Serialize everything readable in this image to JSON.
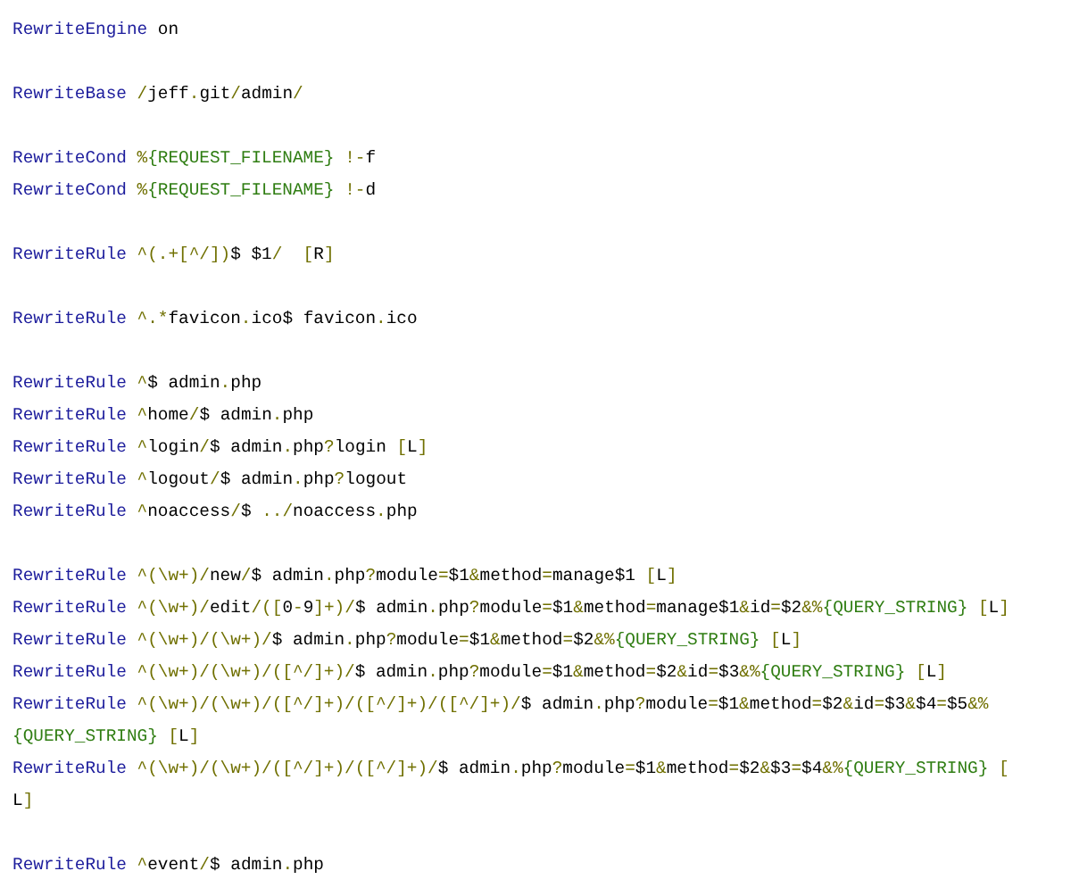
{
  "blocks": [
    [
      {
        "text": "RewriteEngine on"
      }
    ],
    [
      {
        "text": "RewriteBase /jeff.git/admin/"
      }
    ],
    [
      {
        "text": "RewriteCond %{REQUEST_FILENAME} !-f"
      },
      {
        "text": "RewriteCond %{REQUEST_FILENAME} !-d"
      }
    ],
    [
      {
        "text": "RewriteRule ^(.+[^/])$ $1/  [R]"
      }
    ],
    [
      {
        "text": "RewriteRule ^.*favicon.ico$ favicon.ico"
      }
    ],
    [
      {
        "text": "RewriteRule ^$ admin.php"
      },
      {
        "text": "RewriteRule ^home/$ admin.php"
      },
      {
        "text": "RewriteRule ^login/$ admin.php?login [L]"
      },
      {
        "text": "RewriteRule ^logout/$ admin.php?logout"
      },
      {
        "text": "RewriteRule ^noaccess/$ ../noaccess.php"
      }
    ],
    [
      {
        "text": "RewriteRule ^(\\w+)/new/$ admin.php?module=$1&method=manage$1 [L]"
      },
      {
        "text": "RewriteRule ^(\\w+)/edit/([0-9]+)/$ admin.php?module=$1&method=manage$1&id=$2&%{QUERY_STRING} [L]"
      },
      {
        "text": "RewriteRule ^(\\w+)/(\\w+)/$ admin.php?module=$1&method=$2&%{QUERY_STRING} [L]"
      },
      {
        "text": "RewriteRule ^(\\w+)/(\\w+)/([^/]+)/$ admin.php?module=$1&method=$2&id=$3&%{QUERY_STRING} [L]"
      },
      {
        "text": "RewriteRule ^(\\w+)/(\\w+)/([^/]+)/([^/]+)/([^/]+)/$ admin.php?module=$1&method=$2&id=$3&$4=$5&%{QUERY_STRING} [L]"
      },
      {
        "text": "RewriteRule ^(\\w+)/(\\w+)/([^/]+)/([^/]+)/$ admin.php?module=$1&method=$2&$3=$4&%{QUERY_STRING} [L]"
      }
    ],
    [
      {
        "text": "RewriteRule ^event/$ admin.php"
      }
    ]
  ]
}
